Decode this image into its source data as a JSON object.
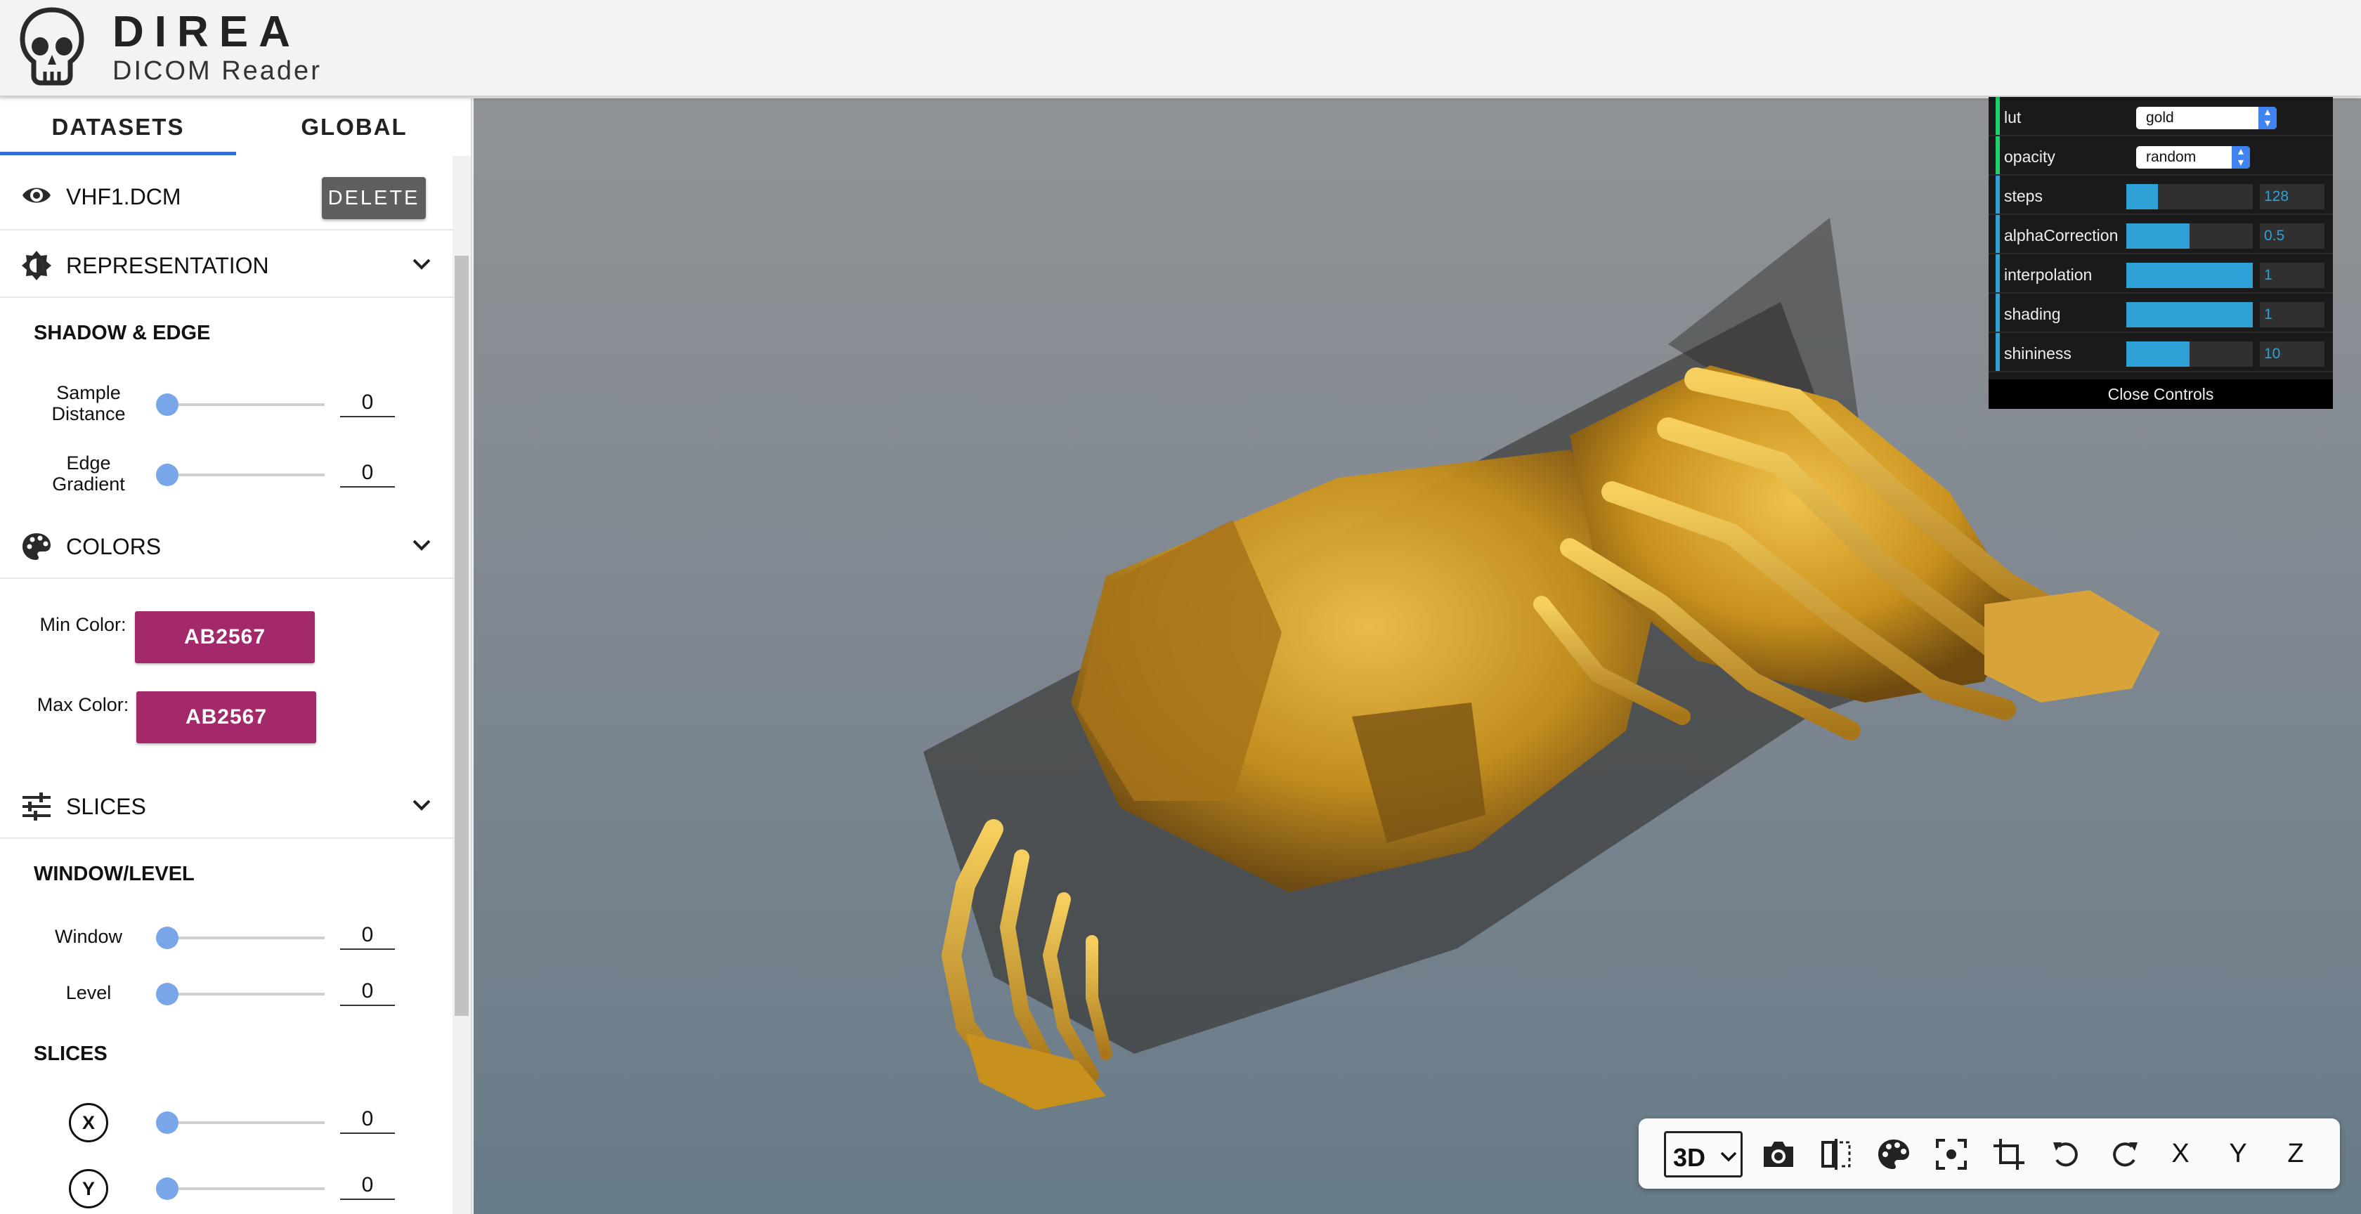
{
  "app": {
    "title": "DIREA",
    "subtitle": "DICOM Reader"
  },
  "tabs": [
    {
      "label": "DATASETS"
    },
    {
      "label": "GLOBAL"
    }
  ],
  "dataset": {
    "name": "VHF1.DCM",
    "delete_label": "DELETE"
  },
  "sections": {
    "representation": {
      "title": "REPRESENTATION",
      "subheading": "SHADOW & EDGE",
      "sample_distance": {
        "label": "Sample Distance",
        "value": "0"
      },
      "edge_gradient": {
        "label": "Edge Gradient",
        "value": "0"
      }
    },
    "colors": {
      "title": "COLORS",
      "min": {
        "label": "Min Color:",
        "value": "AB2567"
      },
      "max": {
        "label": "Max Color:",
        "value": "AB2567"
      }
    },
    "slices": {
      "title": "SLICES",
      "window_level_heading": "WINDOW/LEVEL",
      "window": {
        "label": "Window",
        "value": "0"
      },
      "level": {
        "label": "Level",
        "value": "0"
      },
      "slices_heading": "SLICES",
      "x": {
        "label": "X",
        "value": "0"
      },
      "y": {
        "label": "Y",
        "value": "0"
      }
    }
  },
  "controls": {
    "lut": {
      "label": "lut",
      "value": "gold"
    },
    "opacity": {
      "label": "opacity",
      "value": "random"
    },
    "steps": {
      "label": "steps",
      "value": "128",
      "level": 0.25
    },
    "alphaCorrection": {
      "label": "alphaCorrection",
      "value": "0.5",
      "level": 0.5
    },
    "interpolation": {
      "label": "interpolation",
      "value": "1",
      "level": 1.0
    },
    "shading": {
      "label": "shading",
      "value": "1",
      "level": 1.0
    },
    "shininess": {
      "label": "shininess",
      "value": "10",
      "level": 0.5
    },
    "close_label": "Close Controls"
  },
  "toolbar": {
    "mode": "3D",
    "axis_x": "X",
    "axis_y": "Y",
    "axis_z": "Z"
  },
  "colors": {
    "accent_blue": "#2f6fd6",
    "slider_thumb": "#78a6e8",
    "color_swatch": "#a3296a",
    "gui_bar": "#2fa1d6",
    "bone_gold": "#c8901c"
  }
}
